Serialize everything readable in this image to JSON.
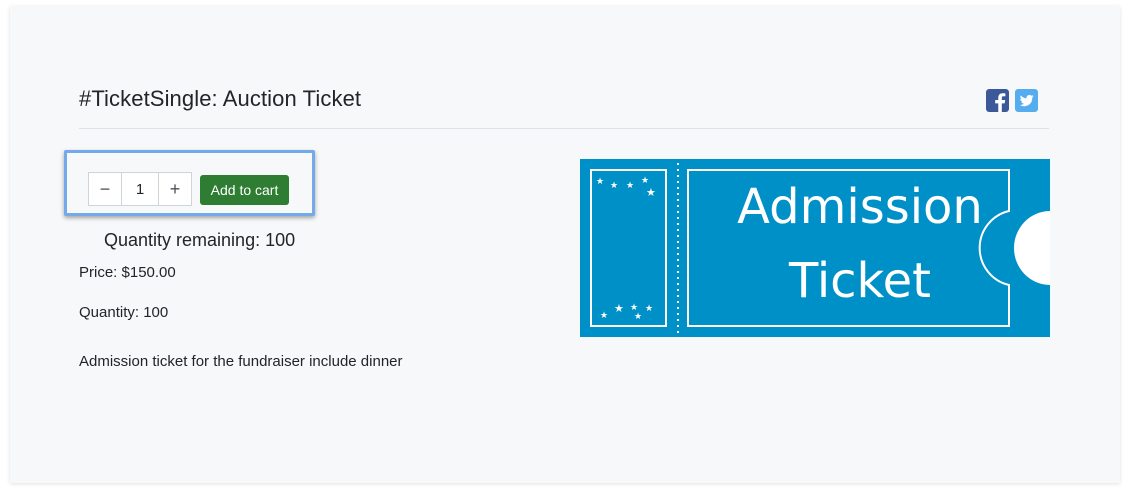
{
  "product": {
    "title": "#TicketSingle: Auction Ticket",
    "quantity_remaining": "Quantity remaining: 100",
    "price": "Price: $150.00",
    "quantity": "Quantity: 100",
    "description": "Admission ticket for the fundraiser include dinner"
  },
  "cart": {
    "decrement_label": "−",
    "quantity_value": "1",
    "increment_label": "+",
    "add_to_cart_label": "Add to cart"
  },
  "ticket_image": {
    "line1": "Admission",
    "line2": "Ticket"
  },
  "social": {
    "facebook_icon": "facebook-icon",
    "twitter_icon": "twitter-icon"
  },
  "colors": {
    "accent_green": "#2e7d32",
    "ticket_blue": "#0090c8",
    "facebook_blue": "#3b5998",
    "twitter_blue": "#55acee",
    "highlight_blue": "#74a9ea"
  }
}
